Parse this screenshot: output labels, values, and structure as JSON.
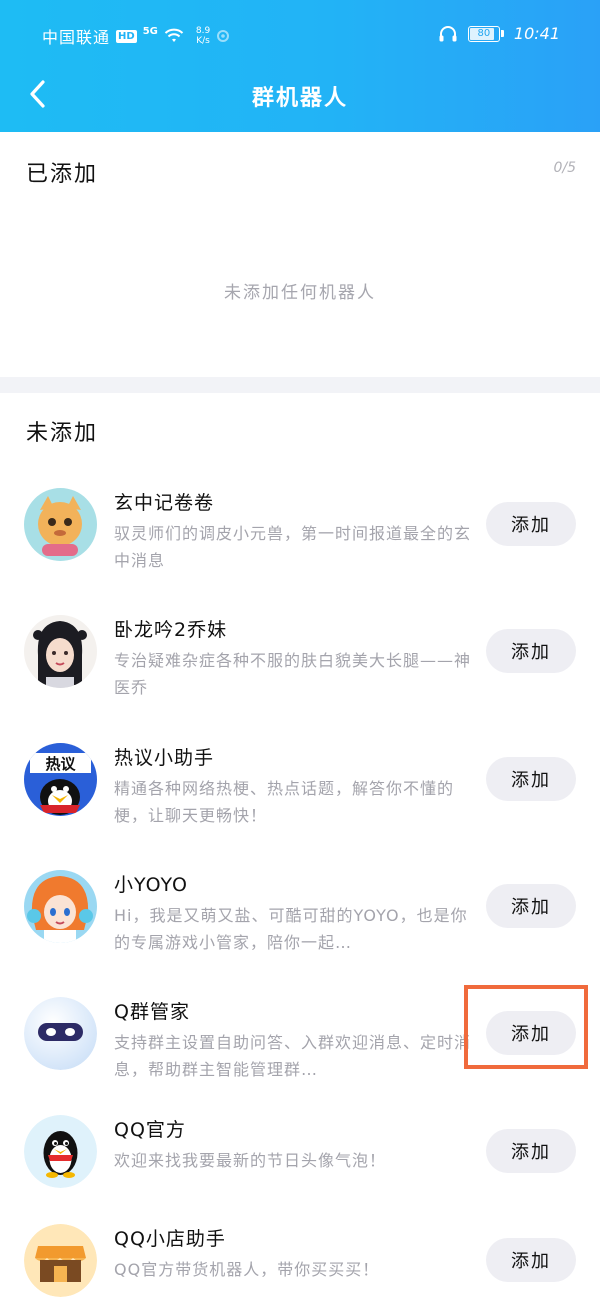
{
  "status_bar": {
    "carrier": "中国联通",
    "hd": "HD",
    "signal": "5G",
    "net_speed_value": "8.9",
    "net_speed_unit": "K/s",
    "battery": "80",
    "time": "10:41"
  },
  "header": {
    "title": "群机器人"
  },
  "added": {
    "title": "已添加",
    "count": "0/5",
    "empty_text": "未添加任何机器人"
  },
  "not_added": {
    "title": "未添加",
    "add_label": "添加",
    "bots": [
      {
        "name": "玄中记卷卷",
        "desc": "驭灵师们的调皮小元兽，第一时间报道最全的玄中消息"
      },
      {
        "name": "卧龙吟2乔妹",
        "desc": "专治疑难杂症各种不服的肤白貌美大长腿——神医乔"
      },
      {
        "name": "热议小助手",
        "desc": "精通各种网络热梗、热点话题，解答你不懂的梗，让聊天更畅快！",
        "avatar_text": "热议"
      },
      {
        "name": "小YOYO",
        "desc": "Hi，我是又萌又盐、可酷可甜的YOYO，也是你的专属游戏小管家，陪你一起…"
      },
      {
        "name": "Q群管家",
        "desc": "支持群主设置自助问答、入群欢迎消息、定时消息，帮助群主智能管理群…"
      },
      {
        "name": "QQ官方",
        "desc": "欢迎来找我要最新的节日头像气泡！"
      },
      {
        "name": "QQ小店助手",
        "desc": "QQ官方带货机器人，带你买买买！"
      }
    ]
  },
  "colors": {
    "header_gradient_start": "#1ebcf4",
    "header_gradient_end": "#2aa1f7",
    "highlight": "#f06a3c"
  }
}
